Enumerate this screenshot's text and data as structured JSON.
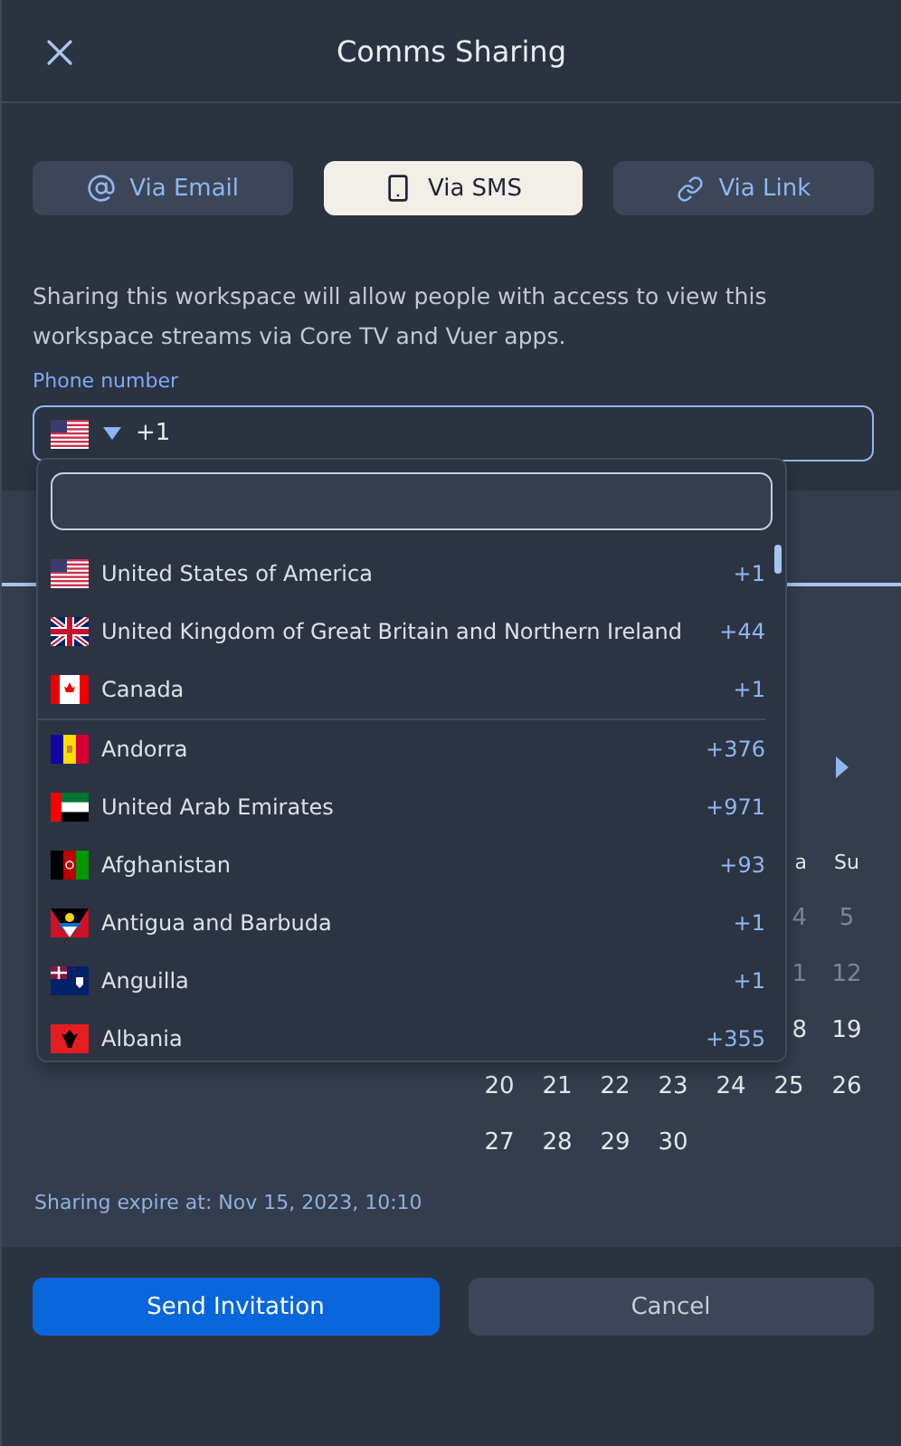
{
  "header": {
    "title": "Comms Sharing"
  },
  "tabs": [
    {
      "label": "Via Email",
      "kind": "email",
      "selected": false
    },
    {
      "label": "Via SMS",
      "kind": "sms",
      "selected": true
    },
    {
      "label": "Via Link",
      "kind": "link",
      "selected": false
    }
  ],
  "description": "Sharing this workspace will allow people with access to view this workspace streams via Core TV and Vuer apps.",
  "phone": {
    "label": "Phone number",
    "value": "+1",
    "expanded": true
  },
  "country_menu": {
    "preferred": [
      {
        "name": "United States of America",
        "code": "+1"
      },
      {
        "name": "United Kingdom of Great Britain and Northern Ireland",
        "code": "+44"
      },
      {
        "name": "Canada",
        "code": "+1"
      }
    ],
    "all": [
      {
        "name": "Andorra",
        "code": "+376"
      },
      {
        "name": "United Arab Emirates",
        "code": "+971"
      },
      {
        "name": "Afghanistan",
        "code": "+93"
      },
      {
        "name": "Antigua and Barbuda",
        "code": "+1"
      },
      {
        "name": "Anguilla",
        "code": "+1"
      },
      {
        "name": "Albania",
        "code": "+355"
      }
    ]
  },
  "calendar": {
    "weekdays": [
      "a",
      "Su"
    ],
    "weeks": [
      [
        "4",
        "5"
      ],
      [
        "1",
        "12"
      ],
      [
        "8",
        "19"
      ],
      [
        "20",
        "21",
        "22",
        "23",
        "24",
        "25",
        "26"
      ],
      [
        "27",
        "28",
        "29",
        "30"
      ]
    ]
  },
  "expiry": "Sharing expire at: Nov 15, 2023, 10:10",
  "buttons": [
    {
      "label": "Send Invitation",
      "kind": "primary"
    },
    {
      "label": "Cancel",
      "kind": "secondary"
    }
  ]
}
